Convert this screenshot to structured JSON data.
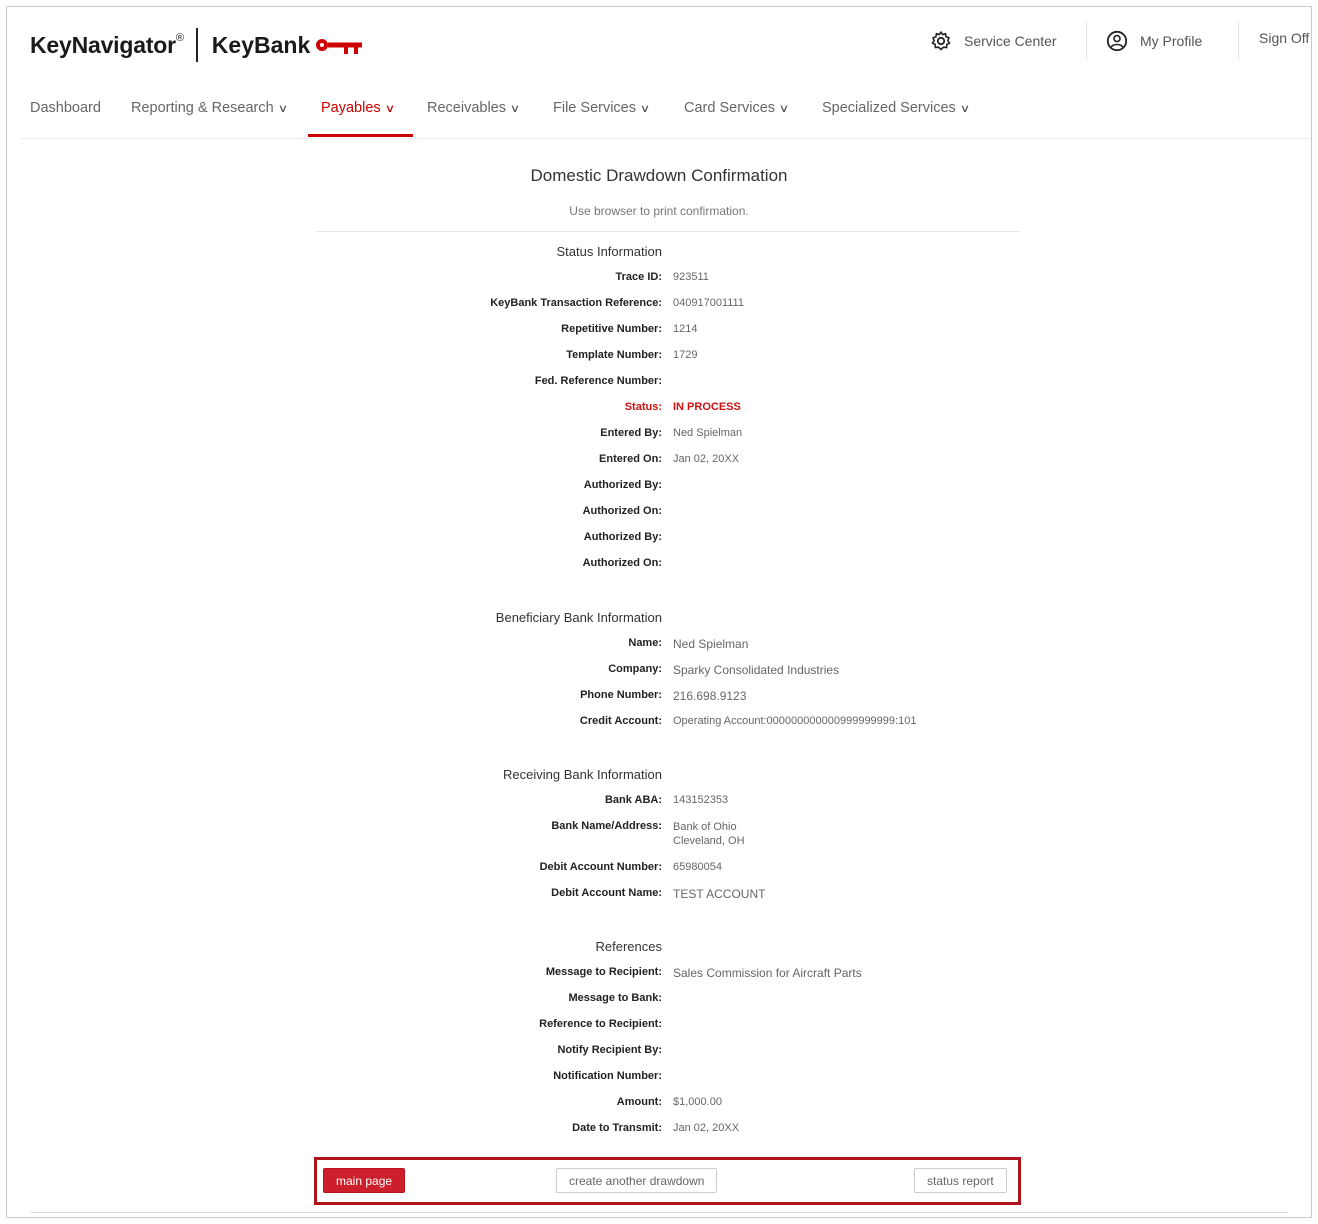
{
  "header": {
    "brand_name": "KeyNavigator",
    "brand_reg": "®",
    "bank_name": "KeyBank",
    "service_center": "Service Center",
    "my_profile": "My Profile",
    "sign_off": "Sign Off",
    "icons": [
      "key-logo-icon",
      "gear-icon",
      "profile-icon"
    ],
    "accent_color": "#cc0000"
  },
  "nav": {
    "items": [
      {
        "label": "Dashboard",
        "has_menu": false
      },
      {
        "label": "Reporting & Research",
        "has_menu": true
      },
      {
        "label": "Payables",
        "has_menu": true,
        "active": true
      },
      {
        "label": "Receivables",
        "has_menu": true
      },
      {
        "label": "File Services",
        "has_menu": true
      },
      {
        "label": "Card Services",
        "has_menu": true
      },
      {
        "label": "Specialized Services",
        "has_menu": true
      }
    ],
    "chevron": "∨"
  },
  "page": {
    "title": "Domestic Drawdown Confirmation",
    "subtitle": "Use browser to print confirmation."
  },
  "status_info": {
    "heading": "Status Information",
    "trace_id": {
      "label": "Trace ID:",
      "value": "923511"
    },
    "txn_ref": {
      "label": "KeyBank Transaction Reference:",
      "value": "040917001111"
    },
    "repetitive": {
      "label": "Repetitive Number:",
      "value": "1214"
    },
    "template": {
      "label": "Template Number:",
      "value": "1729"
    },
    "fed_ref": {
      "label": "Fed. Reference Number:",
      "value": ""
    },
    "status": {
      "label": "Status:",
      "value": "IN PROCESS"
    },
    "entered_by": {
      "label": "Entered By:",
      "value": "Ned Spielman"
    },
    "entered_on": {
      "label": "Entered On:",
      "value": "Jan 02, 20XX"
    },
    "auth_by_1": {
      "label": "Authorized By:",
      "value": ""
    },
    "auth_on_1": {
      "label": "Authorized On:",
      "value": ""
    },
    "auth_by_2": {
      "label": "Authorized By:",
      "value": ""
    },
    "auth_on_2": {
      "label": "Authorized On:",
      "value": ""
    }
  },
  "beneficiary": {
    "heading": "Beneficiary Bank Information",
    "name": {
      "label": "Name:",
      "value": "Ned Spielman"
    },
    "company": {
      "label": "Company:",
      "value": "Sparky Consolidated Industries"
    },
    "phone": {
      "label": "Phone Number:",
      "value": "216.698.9123"
    },
    "credit_account": {
      "label": "Credit Account:",
      "value": "Operating Account:000000000000999999999:101"
    }
  },
  "receiving": {
    "heading": "Receiving Bank Information",
    "aba": {
      "label": "Bank ABA:",
      "value": "143152353"
    },
    "name_address": {
      "label": "Bank Name/Address:",
      "line1": "Bank of Ohio",
      "line2": "Cleveland, OH"
    },
    "debit_number": {
      "label": "Debit Account Number:",
      "value": "65980054"
    },
    "debit_name": {
      "label": "Debit Account Name:",
      "value": "TEST ACCOUNT"
    }
  },
  "references": {
    "heading": "References",
    "msg_recipient": {
      "label": "Message to Recipient:",
      "value": "Sales Commission for Aircraft Parts"
    },
    "msg_bank": {
      "label": "Message to Bank:",
      "value": ""
    },
    "ref_recipient": {
      "label": "Reference to Recipient:",
      "value": ""
    },
    "notify_by": {
      "label": "Notify Recipient By:",
      "value": ""
    },
    "notif_number": {
      "label": "Notification Number:",
      "value": ""
    },
    "amount": {
      "label": "Amount:",
      "value": "$1,000.00"
    },
    "date_transmit": {
      "label": "Date to Transmit:",
      "value": "Jan 02, 20XX"
    }
  },
  "actions": {
    "main_page": "main page",
    "create_another": "create another drawdown",
    "status_report": "status report"
  }
}
